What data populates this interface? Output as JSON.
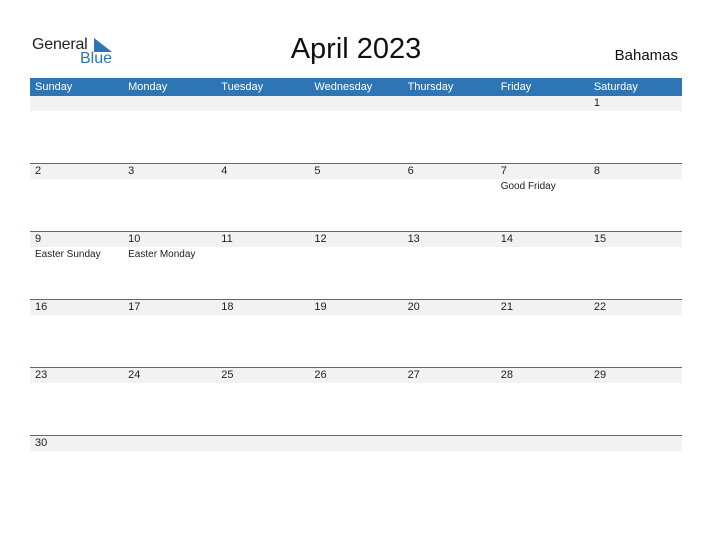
{
  "logo": {
    "general": "General",
    "blue": "Blue"
  },
  "title": "April 2023",
  "country": "Bahamas",
  "colors": {
    "accent": "#2e75b6",
    "strip": "#f2f2f2"
  },
  "weekdays": [
    "Sunday",
    "Monday",
    "Tuesday",
    "Wednesday",
    "Thursday",
    "Friday",
    "Saturday"
  ],
  "weeks": [
    {
      "days": [
        "",
        "",
        "",
        "",
        "",
        "",
        "1"
      ],
      "events": [
        "",
        "",
        "",
        "",
        "",
        "",
        ""
      ]
    },
    {
      "days": [
        "2",
        "3",
        "4",
        "5",
        "6",
        "7",
        "8"
      ],
      "events": [
        "",
        "",
        "",
        "",
        "",
        "Good Friday",
        ""
      ]
    },
    {
      "days": [
        "9",
        "10",
        "11",
        "12",
        "13",
        "14",
        "15"
      ],
      "events": [
        "Easter Sunday",
        "Easter Monday",
        "",
        "",
        "",
        "",
        ""
      ]
    },
    {
      "days": [
        "16",
        "17",
        "18",
        "19",
        "20",
        "21",
        "22"
      ],
      "events": [
        "",
        "",
        "",
        "",
        "",
        "",
        ""
      ]
    },
    {
      "days": [
        "23",
        "24",
        "25",
        "26",
        "27",
        "28",
        "29"
      ],
      "events": [
        "",
        "",
        "",
        "",
        "",
        "",
        ""
      ]
    },
    {
      "days": [
        "30",
        "",
        "",
        "",
        "",
        "",
        ""
      ],
      "events": [
        "",
        "",
        "",
        "",
        "",
        "",
        ""
      ]
    }
  ]
}
